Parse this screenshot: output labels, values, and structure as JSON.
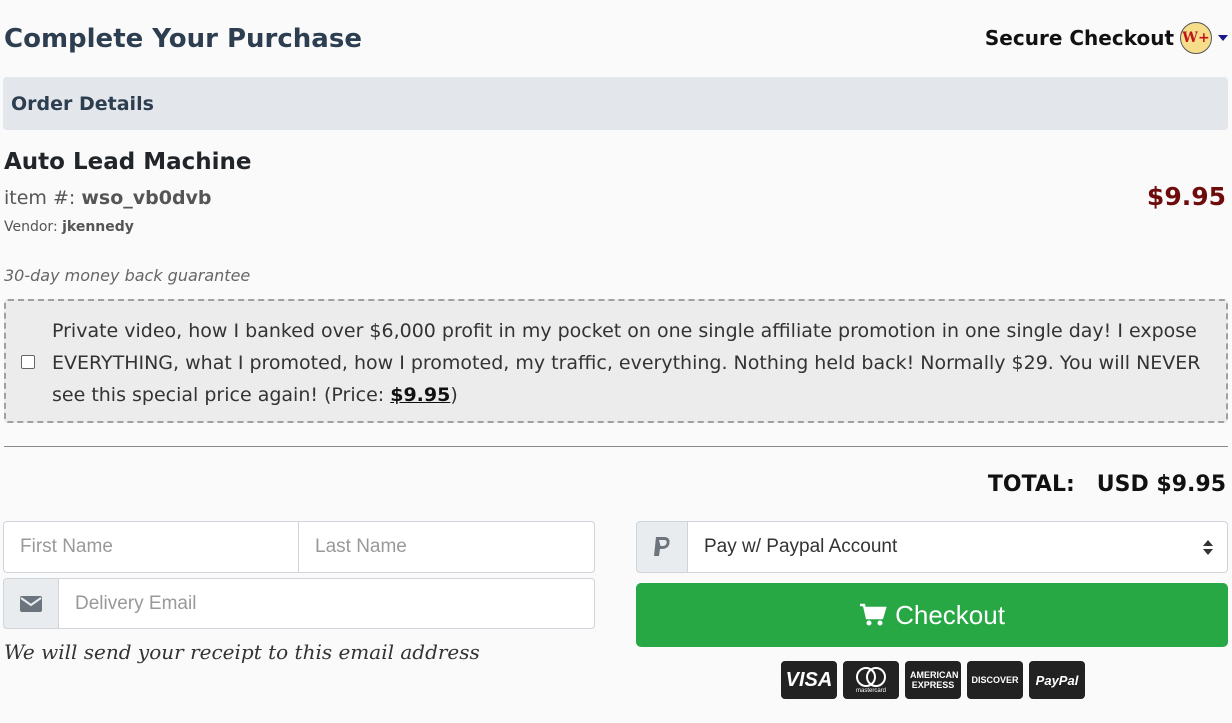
{
  "header": {
    "title": "Complete Your Purchase",
    "secure_label": "Secure Checkout",
    "logo_text": "W+"
  },
  "order": {
    "section_title": "Order Details",
    "product_name": "Auto Lead Machine",
    "item_prefix": "item #: ",
    "item_id": "wso_vb0dvb",
    "vendor_prefix": "Vendor: ",
    "vendor": "jkennedy",
    "price": "$9.95",
    "guarantee": "30-day money back guarantee"
  },
  "bump": {
    "checked": false,
    "text": "Private video, how I banked over $6,000 profit in my pocket on one single affiliate promotion in one single day! I expose EVERYTHING, what I promoted, how I promoted, my traffic, everything. Nothing held back! Normally $29. You will NEVER see this special price again! (Price: ",
    "price": "$9.95",
    "suffix": ")"
  },
  "total": {
    "label": "TOTAL:",
    "value": "USD $9.95"
  },
  "form": {
    "first_name_placeholder": "First Name",
    "last_name_placeholder": "Last Name",
    "email_placeholder": "Delivery Email",
    "receipt_note": "We will send your receipt to this email address"
  },
  "payment": {
    "selected_method": "Pay w/ Paypal Account",
    "checkout_label": "Checkout",
    "cards": [
      "VISA",
      "mastercard",
      "AMERICAN EXPRESS",
      "DISCOVER",
      "PayPal"
    ]
  },
  "colors": {
    "checkout_green": "#28a745",
    "price_red": "#6e0b0b",
    "header_bg": "#e3e6ea"
  }
}
